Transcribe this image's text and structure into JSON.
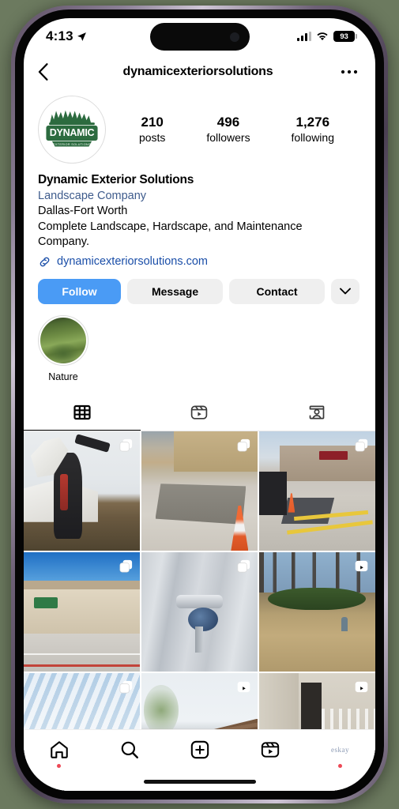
{
  "status_bar": {
    "time": "4:13",
    "location_icon": "location-arrow-icon",
    "cellular_icon": "cellular-bars-icon",
    "wifi_icon": "wifi-icon",
    "battery_percent": "93"
  },
  "header": {
    "back_icon": "chevron-left-icon",
    "username": "dynamicexteriorsolutions",
    "more_icon": "ellipsis-icon"
  },
  "profile": {
    "avatar_name": "profile-avatar-dynamic-exterior-solutions",
    "logo_wordmark": "DYNAMIC",
    "logo_subtext": "EXTERIOR SOLUTIONS",
    "stats": [
      {
        "value": "210",
        "label": "posts",
        "name": "posts"
      },
      {
        "value": "496",
        "label": "followers",
        "name": "followers"
      },
      {
        "value": "1,276",
        "label": "following",
        "name": "following"
      }
    ],
    "full_name": "Dynamic Exterior Solutions",
    "category": "Landscape Company",
    "bio_lines": [
      "Dallas-Fort Worth",
      "Complete Landscape, Hardscape, and Maintenance",
      "Company."
    ],
    "website": "dynamicexteriorsolutions.com",
    "link_icon": "link-chain-icon"
  },
  "actions": {
    "follow_label": "Follow",
    "message_label": "Message",
    "contact_label": "Contact",
    "dropdown_icon": "chevron-down-icon",
    "follow_color": "#4a9bf5",
    "secondary_color": "#efefef"
  },
  "highlights": [
    {
      "label": "Nature",
      "name": "highlight-nature"
    }
  ],
  "tabs": [
    {
      "name": "tab-grid",
      "icon": "grid-icon",
      "active": true
    },
    {
      "name": "tab-reels",
      "icon": "reels-icon",
      "active": false
    },
    {
      "name": "tab-tagged",
      "icon": "tagged-person-icon",
      "active": false
    }
  ],
  "grid": {
    "posts": [
      {
        "name": "post-excavator-worker",
        "scene": "ph-excavator",
        "badge": "carousel-icon",
        "alt": "Worker with hose beside mini excavator at house"
      },
      {
        "name": "post-concrete-pad",
        "scene": "ph-concrete",
        "badge": "carousel-icon",
        "alt": "Fresh concrete pad behind building with traffic cone"
      },
      {
        "name": "post-kohls-parking-lot",
        "scene": "ph-kohls",
        "badge": "carousel-icon",
        "alt": "Kohl's storefront parking lot repair"
      },
      {
        "name": "post-dollar-tree-lot",
        "scene": "ph-dollartree",
        "badge": "carousel-icon",
        "alt": "Dollar Tree building and striped parking lot"
      },
      {
        "name": "post-faucet-fixture",
        "scene": "ph-faucet",
        "badge": "carousel-icon",
        "alt": "Outdoor spigot faucet on metal siding"
      },
      {
        "name": "post-leaf-cleanup-reel",
        "scene": "ph-leaves",
        "badge": "reel-icon",
        "alt": "Leaf covered yard with hedges and trees"
      },
      {
        "name": "post-sky-clouds",
        "scene": "ph-sky",
        "badge": "carousel-icon",
        "alt": "Cloudy blue sky"
      },
      {
        "name": "post-roof-reel",
        "scene": "ph-roof",
        "badge": "reel-icon",
        "alt": "Brown shingle roof and tree"
      },
      {
        "name": "post-porch-reel",
        "scene": "ph-porch",
        "badge": "reel-icon",
        "alt": "House porch with white railing and stone steps"
      }
    ],
    "badge_labels": {
      "carousel-icon": "Carousel post",
      "reel-icon": "Reel video"
    }
  },
  "bottom_nav": [
    {
      "name": "nav-home",
      "icon": "home-icon",
      "badge_dot": true
    },
    {
      "name": "nav-search",
      "icon": "search-icon",
      "badge_dot": false
    },
    {
      "name": "nav-create",
      "icon": "plus-square-icon",
      "badge_dot": false
    },
    {
      "name": "nav-reels",
      "icon": "reels-icon",
      "badge_dot": false
    },
    {
      "name": "nav-profile",
      "icon": "user-avatar-eskay",
      "badge_dot": true,
      "avatar_text": "eskay"
    }
  ]
}
